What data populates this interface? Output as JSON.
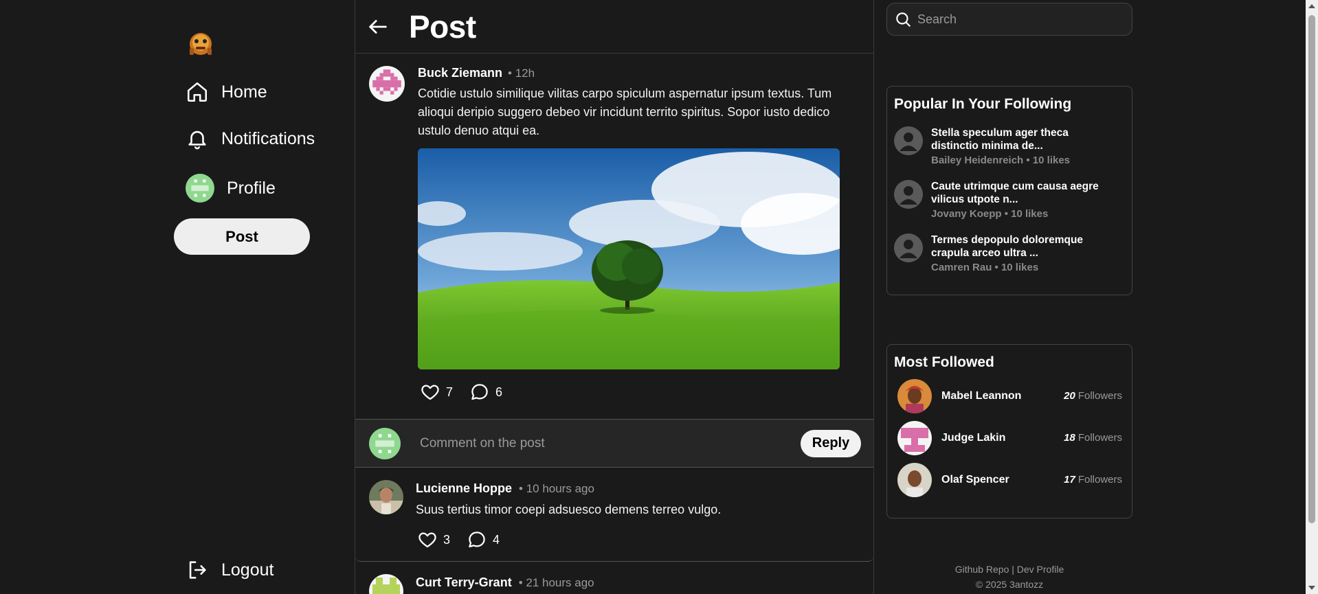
{
  "nav": {
    "home": "Home",
    "notifications": "Notifications",
    "profile": "Profile",
    "post_button": "Post",
    "logout": "Logout"
  },
  "header": {
    "title": "Post"
  },
  "post": {
    "author": "Buck Ziemann",
    "time": "• 12h",
    "text": "Cotidie ustulo similique vilitas carpo spiculum aspernatur ipsum textus. Tum alioqui deripio suggero debeo vir incidunt territo spiritus. Sopor iusto dedico ustulo denuo atqui ea.",
    "likes": "7",
    "comments": "6"
  },
  "comment_box": {
    "placeholder": "Comment on the post",
    "reply": "Reply"
  },
  "comments": [
    {
      "author": "Lucienne Hoppe",
      "time": "• 10 hours ago",
      "text": "Suus tertius timor coepi adsuesco demens terreo vulgo.",
      "likes": "3",
      "replies": "4"
    },
    {
      "author": "Curt Terry-Grant",
      "time": "• 21 hours ago"
    }
  ],
  "search": {
    "placeholder": "Search"
  },
  "popular": {
    "title": "Popular In Your Following",
    "items": [
      {
        "title": "Stella speculum ager theca distinctio minima de...",
        "sub": "Bailey Heidenreich • 10 likes"
      },
      {
        "title": "Caute utrimque cum causa aegre vilicus utpote n...",
        "sub": "Jovany Koepp • 10 likes"
      },
      {
        "title": "Termes depopulo doloremque crapula arceo ultra ...",
        "sub": "Camren Rau • 10 likes"
      }
    ]
  },
  "most_followed": {
    "title": "Most Followed",
    "followers_label": "Followers",
    "items": [
      {
        "name": "Mabel Leannon",
        "count": "20"
      },
      {
        "name": "Judge Lakin",
        "count": "18"
      },
      {
        "name": "Olaf Spencer",
        "count": "17"
      }
    ]
  },
  "footer": {
    "links": "Github Repo | Dev Profile",
    "copyright": "© 2025 3antozz"
  },
  "colors": {
    "background": "#1a1a1a",
    "pink_identicon": "#d96fa8",
    "green_identicon": "#8fd88f"
  }
}
